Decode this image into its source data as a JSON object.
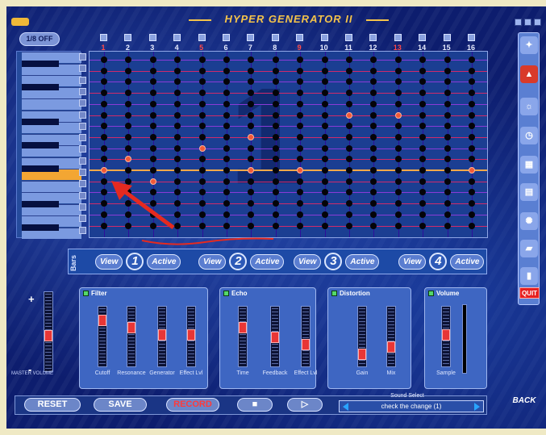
{
  "app": {
    "title": "HYPER GENERATOR II"
  },
  "top": {
    "button": "1/8 OFF"
  },
  "grid": {
    "columns": [
      "1",
      "2",
      "3",
      "4",
      "5",
      "6",
      "7",
      "8",
      "9",
      "10",
      "11",
      "12",
      "13",
      "14",
      "15",
      "16"
    ],
    "accent_columns": [
      0,
      4,
      8,
      12
    ],
    "rows": 16,
    "highlight_row": 10,
    "active_cells": [
      [
        0,
        10
      ],
      [
        1,
        9
      ],
      [
        2,
        11
      ],
      [
        4,
        8
      ],
      [
        6,
        10
      ],
      [
        6,
        7
      ],
      [
        8,
        10
      ],
      [
        10,
        5
      ],
      [
        12,
        5
      ],
      [
        15,
        10
      ]
    ],
    "big_number": "1",
    "colors": {
      "dot": "#040408",
      "active_dot": "#f05a38",
      "hline": "#a02ad6",
      "vline": "#2d0f9a",
      "highlight": "#f3a84a"
    }
  },
  "bars": {
    "label": "Bars",
    "items": [
      {
        "view": "View",
        "number": "1",
        "active": "Active"
      },
      {
        "view": "View",
        "number": "2",
        "active": "Active"
      },
      {
        "view": "View",
        "number": "3",
        "active": "Active"
      },
      {
        "view": "View",
        "number": "4",
        "active": "Active"
      }
    ]
  },
  "master": {
    "plus": "+",
    "minus": "-",
    "label": "MASTER VOLUME",
    "level": 0.45
  },
  "effects": {
    "filter": {
      "title": "Filter",
      "sliders": [
        {
          "label": "Cutoff",
          "level": 0.85
        },
        {
          "label": "Resonance",
          "level": 0.7
        },
        {
          "label": "Generator",
          "level": 0.55
        },
        {
          "label": "Effect Lvl",
          "level": 0.55
        }
      ]
    },
    "echo": {
      "title": "Echo",
      "sliders": [
        {
          "label": "Time",
          "level": 0.7
        },
        {
          "label": "Feedback",
          "level": 0.5
        },
        {
          "label": "Effect Lvl",
          "level": 0.35
        }
      ]
    },
    "distortion": {
      "title": "Distortion",
      "sliders": [
        {
          "label": "Gain",
          "level": 0.15
        },
        {
          "label": "Mix",
          "level": 0.3
        }
      ]
    },
    "volume": {
      "title": "Volume",
      "sliders": [
        {
          "label": "Sample",
          "level": 0.55
        }
      ]
    }
  },
  "bottom": {
    "reset": "RESET",
    "save": "SAVE",
    "record": "RECORD",
    "stop": "■",
    "play": "▷"
  },
  "sound_select": {
    "label": "Sound Select",
    "value": "check the change (1)"
  },
  "side": {
    "quit": "QUIT",
    "back": "BACK"
  }
}
